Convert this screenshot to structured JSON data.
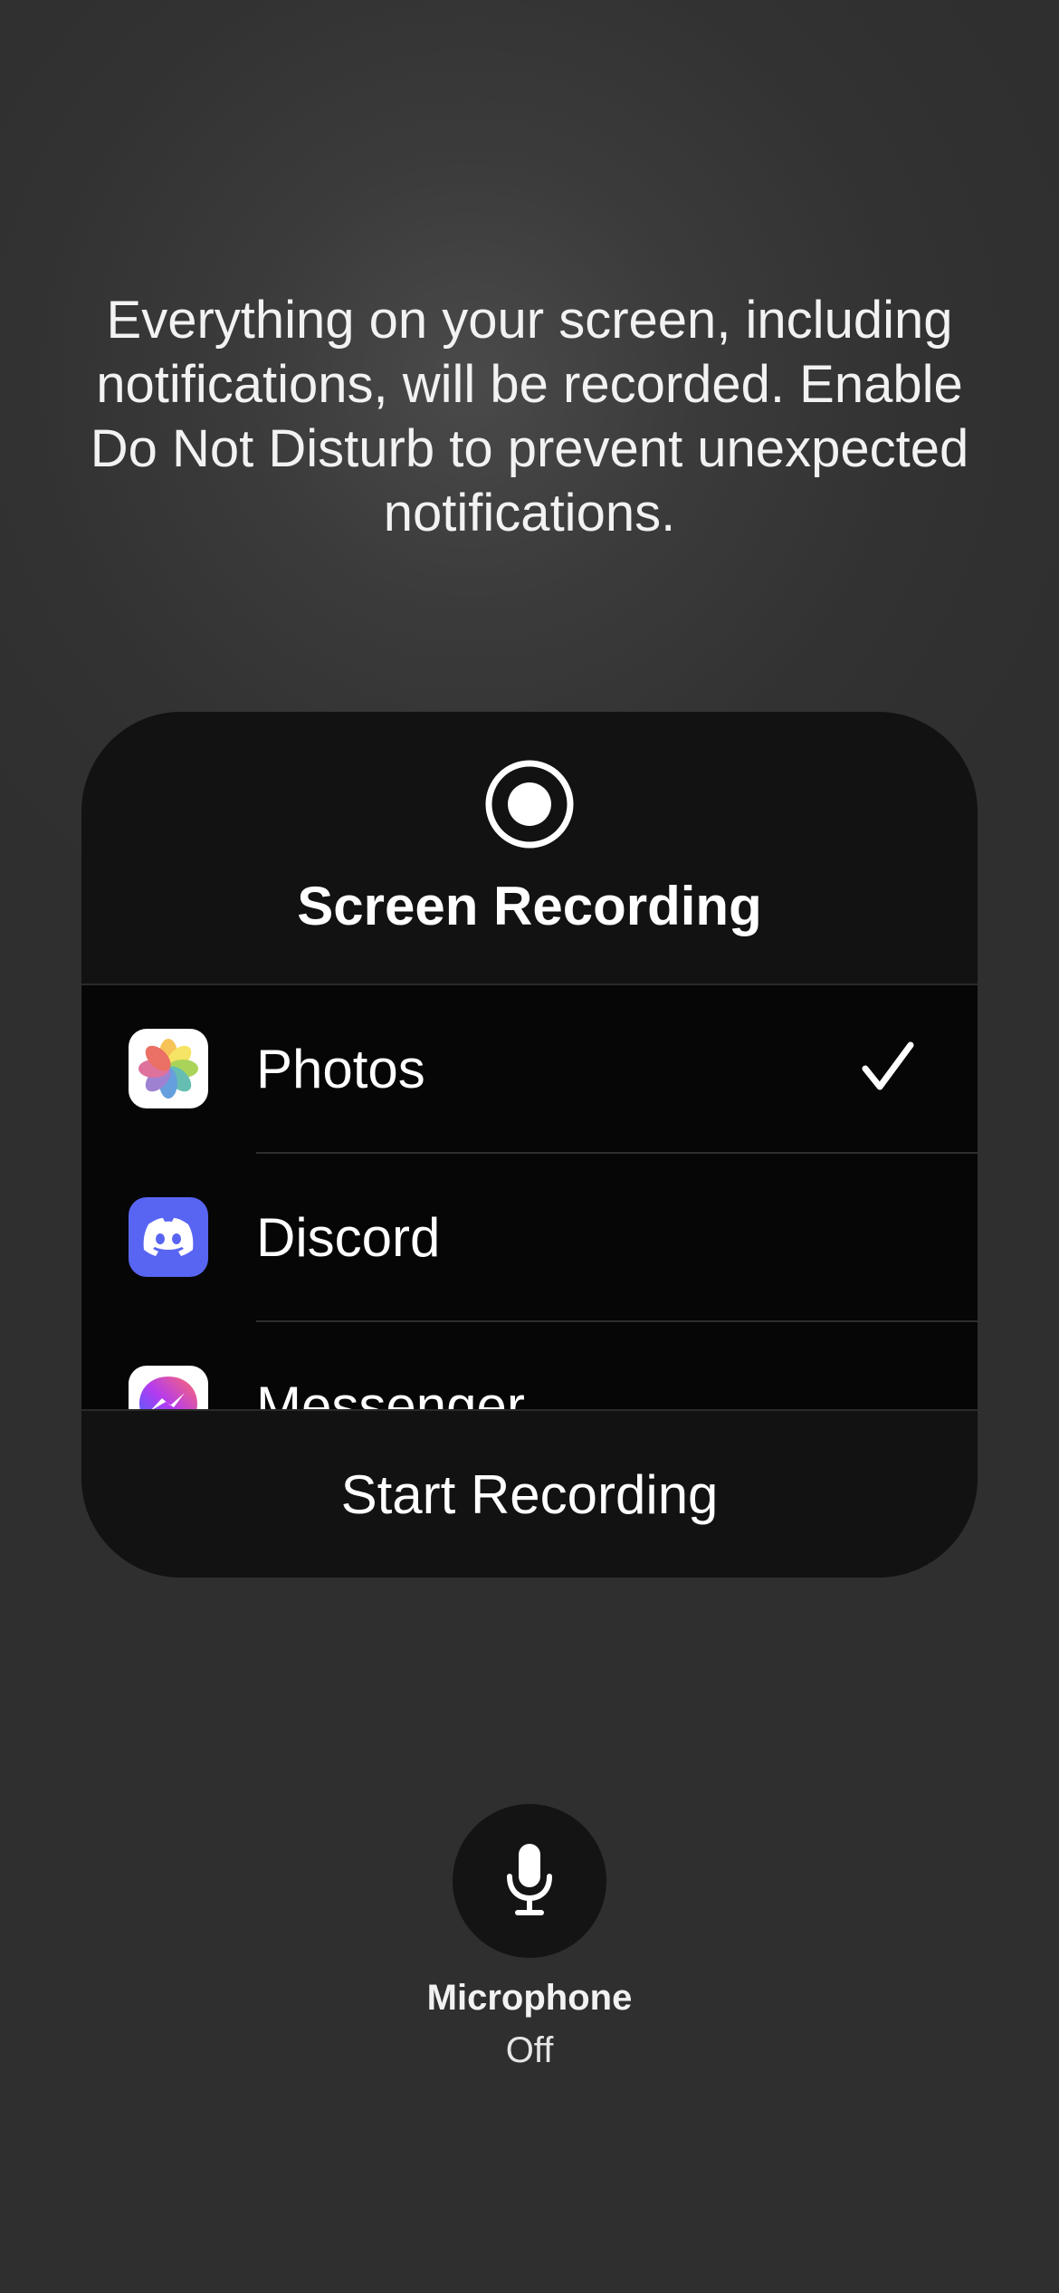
{
  "info": {
    "text": "Everything on your screen, including notifications, will be recorded. Enable Do Not Disturb to prevent unexpected notifications."
  },
  "panel": {
    "title": "Screen Recording",
    "header_icon": "record-icon",
    "apps": [
      {
        "name": "Photos",
        "icon": "photos-app-icon",
        "selected": true
      },
      {
        "name": "Discord",
        "icon": "discord-app-icon",
        "selected": false
      },
      {
        "name": "Messenger",
        "icon": "messenger-app-icon",
        "selected": false
      }
    ],
    "start_label": "Start Recording"
  },
  "microphone": {
    "icon": "microphone-icon",
    "label": "Microphone",
    "status": "Off"
  },
  "colors": {
    "discord": "#5865F2",
    "panel_bg": "#121212",
    "list_bg": "#060606"
  }
}
